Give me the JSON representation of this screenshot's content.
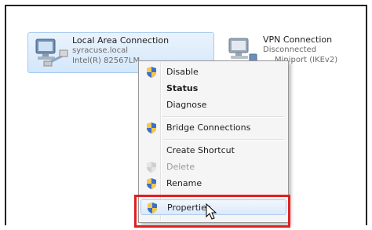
{
  "connections": [
    {
      "name": "Local Area Connection",
      "domain": "syracuse.local",
      "adapter": "Intel(R) 82567LM",
      "adapter_icon": "network-adapter-icon",
      "selected": true
    },
    {
      "name": "VPN Connection",
      "status": "Disconnected",
      "adapter": "Miniport (IKEv2)",
      "adapter_icon": "vpn-adapter-icon",
      "selected": false
    }
  ],
  "context_menu": {
    "items": [
      {
        "label": "Disable",
        "icon": "uac-shield-icon",
        "bold": false,
        "enabled": true
      },
      {
        "label": "Status",
        "icon": "",
        "bold": true,
        "enabled": true
      },
      {
        "label": "Diagnose",
        "icon": "",
        "bold": false,
        "enabled": true
      },
      {
        "label": "Bridge Connections",
        "icon": "uac-shield-icon",
        "bold": false,
        "enabled": true
      },
      {
        "label": "Create Shortcut",
        "icon": "",
        "bold": false,
        "enabled": true
      },
      {
        "label": "Delete",
        "icon": "uac-shield-icon",
        "bold": false,
        "enabled": false
      },
      {
        "label": "Rename",
        "icon": "uac-shield-icon",
        "bold": false,
        "enabled": true
      },
      {
        "label": "Properties",
        "icon": "uac-shield-icon",
        "bold": false,
        "enabled": true,
        "hovered": true
      }
    ]
  },
  "colors": {
    "highlight_annotation": "#e02020",
    "selection": "#d4e7fb",
    "menu_background": "#f5f5f5"
  }
}
